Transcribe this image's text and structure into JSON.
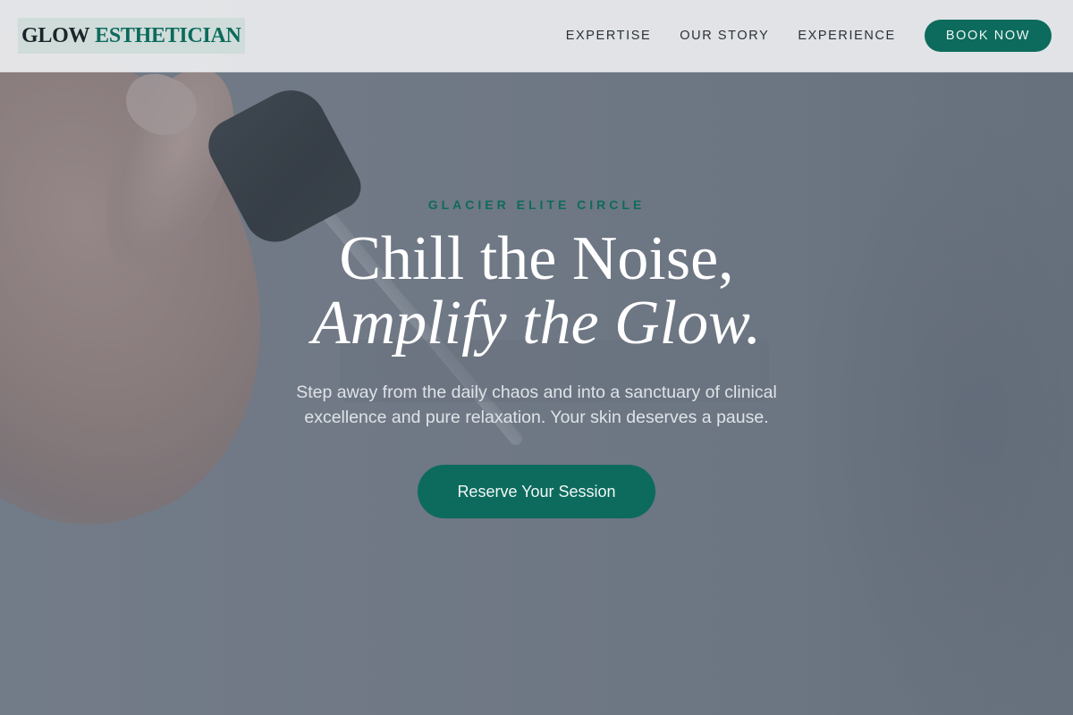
{
  "brand": {
    "name_part1": "GLOW",
    "name_part2": "ESTHETICIAN"
  },
  "nav": {
    "items": [
      {
        "label": "EXPERTISE"
      },
      {
        "label": "OUR STORY"
      },
      {
        "label": "EXPERIENCE"
      }
    ],
    "book_label": "BOOK NOW"
  },
  "hero": {
    "eyebrow": "GLACIER ELITE CIRCLE",
    "headline_line1": "Chill the Noise,",
    "headline_line2": "Amplify the Glow.",
    "subtext": "Step away from the daily chaos and into a sanctuary of clinical excellence and pure relaxation. Your skin deserves a pause.",
    "cta_label": "Reserve Your Session"
  },
  "colors": {
    "accent": "#0c6b5d",
    "header_bg": "#ecedef",
    "overlay": "#6f7884"
  }
}
